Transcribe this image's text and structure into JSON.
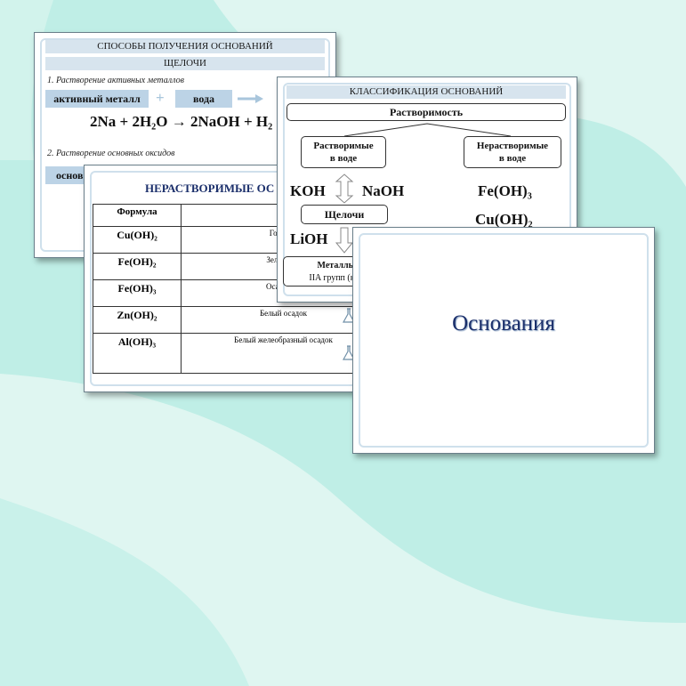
{
  "slide1": {
    "title": "СПОСОБЫ ПОЛУЧЕНИЯ ОСНОВАНИЙ",
    "subtitle": "ЩЕЛОЧИ",
    "method1": "1.  Растворение активных металлов",
    "box_metal": "активный металл",
    "box_water": "вода",
    "equation": "2Na + 2H₂O  →  2NaOH + H₂",
    "method2": "2.  Растворение основных оксидов",
    "box_oxide": "основ"
  },
  "slide2": {
    "title": "НЕРАСТВОРИМЫЕ  ОС",
    "headers": [
      "Формула",
      "Ц"
    ],
    "rows": [
      {
        "formula": "Cu(OH)₂",
        "desc": "Голубой"
      },
      {
        "formula": "Fe(OH)₂",
        "desc": "Зеленоват"
      },
      {
        "formula": "Fe(OH)₃",
        "desc": "Осадок бу"
      },
      {
        "formula": "Zn(OH)₂",
        "desc": "Белый осадок"
      },
      {
        "formula": "Al(OH)₃",
        "desc": "Белый желеобразный осадок"
      }
    ]
  },
  "slide3": {
    "title": "КЛАССИФИКАЦИЯ ОСНОВАНИЙ",
    "root": "Растворимость",
    "left_l1": "Растворимые",
    "left_l2": "в воде",
    "right_l1": "Нерастворимые",
    "right_l2": "в воде",
    "koh": "KOH",
    "naoh": "NaOH",
    "feoh3": "Fe(OH)₃",
    "cuoh2": "Cu(OH)₂",
    "alkali": "Щелочи",
    "lioh": "LiOH",
    "metals_l1": "Металлы",
    "metals_l2": "IIA групп (кро"
  },
  "slide4": {
    "title": "Основания"
  },
  "colors": {
    "background": "#bfeee6",
    "band": "#d7e4ee",
    "blue_box": "#bcd3e6",
    "title_blue": "#1b2f6b"
  }
}
